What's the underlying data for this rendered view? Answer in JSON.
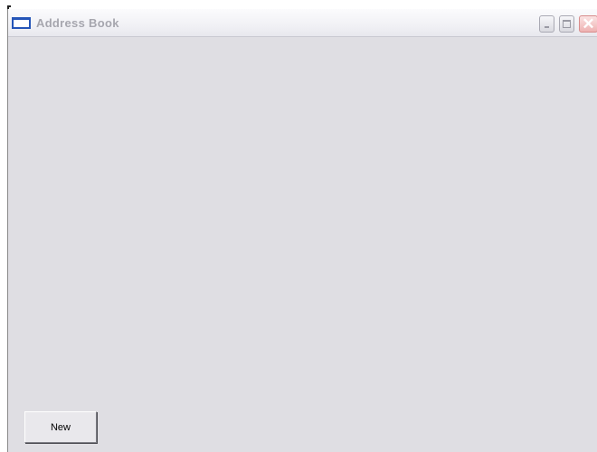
{
  "window": {
    "title": "Address Book"
  },
  "title_bar_buttons": {
    "minimize_icon": "minimize-icon",
    "maximize_icon": "maximize-icon",
    "close_icon": "close-icon",
    "close_glyph": "✕"
  },
  "actions": {
    "new_label": "New"
  },
  "colors": {
    "client_background": "#dfdee3",
    "titlebar_text": "#a6a6ae",
    "app_icon_border": "#2555b8",
    "close_button": "#eeb2b2"
  }
}
